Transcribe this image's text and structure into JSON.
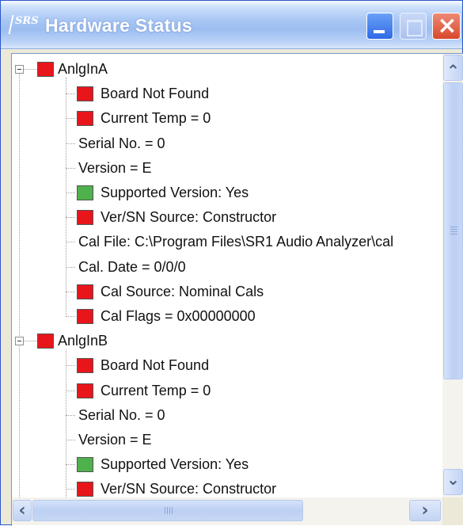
{
  "window": {
    "title": "Hardware Status",
    "icon": "srs-app-icon",
    "icon_text": "SRS",
    "controls": {
      "minimize": "minimize-icon",
      "maximize": "maximize-icon",
      "close": "close-icon",
      "close_glyph": "×"
    }
  },
  "colors": {
    "error": "#e8151b",
    "ok": "#4fb14b",
    "titlebar": "#a9c7f4"
  },
  "tree": {
    "groups": [
      {
        "name": "AnlgInA",
        "status": "error",
        "children": [
          {
            "label": "Board Not Found",
            "status": "error"
          },
          {
            "label": "Current Temp = 0",
            "status": "error"
          },
          {
            "label": "Serial No. = 0",
            "status": "none"
          },
          {
            "label": "Version = E",
            "status": "none"
          },
          {
            "label": "Supported Version: Yes",
            "status": "ok"
          },
          {
            "label": "Ver/SN Source: Constructor",
            "status": "error"
          },
          {
            "label": "Cal File: C:\\Program Files\\SR1 Audio Analyzer\\cal",
            "status": "none"
          },
          {
            "label": "Cal. Date = 0/0/0",
            "status": "none"
          },
          {
            "label": "Cal Source: Nominal Cals",
            "status": "error"
          },
          {
            "label": "Cal Flags = 0x00000000",
            "status": "error"
          }
        ]
      },
      {
        "name": "AnlgInB",
        "status": "error",
        "children": [
          {
            "label": "Board Not Found",
            "status": "error"
          },
          {
            "label": "Current Temp = 0",
            "status": "error"
          },
          {
            "label": "Serial No. = 0",
            "status": "none"
          },
          {
            "label": "Version = E",
            "status": "none"
          },
          {
            "label": "Supported Version: Yes",
            "status": "ok"
          },
          {
            "label": "Ver/SN Source: Constructor",
            "status": "error"
          }
        ]
      }
    ]
  },
  "scrollbars": {
    "vertical": {
      "up": "arrow-up-icon",
      "down": "arrow-down-icon",
      "up_glyph": "⌃",
      "down_glyph": "⌄"
    },
    "horizontal": {
      "left": "arrow-left-icon",
      "right": "arrow-right-icon",
      "left_glyph": "‹",
      "right_glyph": "›"
    }
  }
}
